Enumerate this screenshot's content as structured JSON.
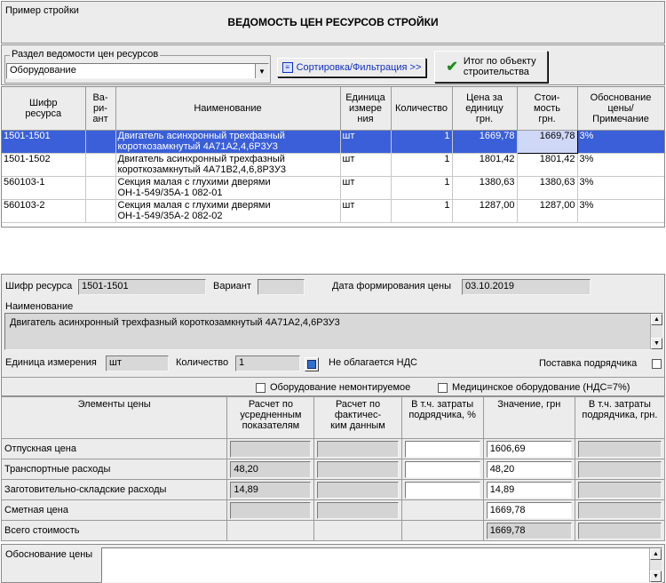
{
  "header": {
    "caption": "Пример стройки",
    "title": "ВЕДОМОСТЬ ЦЕН РЕСУРСОВ СТРОЙКИ"
  },
  "section": {
    "group_label": "Раздел ведомости цен ресурсов",
    "selected": "Оборудование",
    "sort_button": "Сортировка/Фильтрация >>",
    "total_button_line1": "Итог по объекту",
    "total_button_line2": "строительства"
  },
  "grid": {
    "columns": [
      {
        "l1": "Шифр",
        "l2": "ресурса",
        "l3": "",
        "l4": ""
      },
      {
        "l1": "Ва-",
        "l2": "ри-",
        "l3": "ант",
        "l4": ""
      },
      {
        "l1": "Наименование",
        "l2": "",
        "l3": "",
        "l4": ""
      },
      {
        "l1": "Единица",
        "l2": "измере",
        "l3": "ния",
        "l4": ""
      },
      {
        "l1": "Количество",
        "l2": "",
        "l3": "",
        "l4": ""
      },
      {
        "l1": "Цена за",
        "l2": "единицу",
        "l3": "грн.",
        "l4": ""
      },
      {
        "l1": "Стои-",
        "l2": "мость",
        "l3": "грн.",
        "l4": ""
      },
      {
        "l1": "Обоснование",
        "l2": "цены/",
        "l3": "Примечание",
        "l4": ""
      }
    ],
    "rows": [
      {
        "code": "1501-1501",
        "variant": "",
        "name1": "Двигатель асинхронный трехфазный",
        "name2": "короткозамкнутый 4А71А2,4,6Р3У3",
        "unit": "шт",
        "qty": "1",
        "price": "1669,78",
        "cost": "1669,78",
        "note": "3%"
      },
      {
        "code": "1501-1502",
        "variant": "",
        "name1": "Двигатель асинхронный трехфазный",
        "name2": "короткозамкнутый 4А71В2,4,6,8Р3У3",
        "unit": "шт",
        "qty": "1",
        "price": "1801,42",
        "cost": "1801,42",
        "note": "3%"
      },
      {
        "code": "560103-1",
        "variant": "",
        "name1": "Секция малая с глухими дверями",
        "name2": "ОН-1-549/35А-1 082-01",
        "unit": "шт",
        "qty": "1",
        "price": "1380,63",
        "cost": "1380,63",
        "note": "3%"
      },
      {
        "code": "560103-2",
        "variant": "",
        "name1": "Секция малая с глухими дверями",
        "name2": "ОН-1-549/35А-2 082-02",
        "unit": "шт",
        "qty": "1",
        "price": "1287,00",
        "cost": "1287,00",
        "note": "3%"
      }
    ]
  },
  "detail": {
    "code_label": "Шифр ресурса",
    "code": "1501-1501",
    "variant_label": "Вариант",
    "variant": "",
    "date_label": "Дата формирования цены",
    "date": "03.10.2019",
    "name_label": "Наименование",
    "name": "Двигатель асинхронный трехфазный короткозамкнутый 4А71А2,4,6Р3У3",
    "unit_label": "Единица измерения",
    "unit": "шт",
    "qty_label": "Количество",
    "qty": "1",
    "vat_label": "Не облагается НДС",
    "contractor_label": "Поставка подрядчика",
    "not_mounted_label": "Оборудование немонтируемое",
    "medical_label": "Медицинское оборудование (НДС=7%)",
    "justification_label": "Обоснование цены"
  },
  "price_table": {
    "headers": {
      "c1": "Элементы цены",
      "c2_1": "Расчет по",
      "c2_2": "усредненным",
      "c2_3": "показателям",
      "c3_1": "Расчет по",
      "c3_2": "фактичес-",
      "c3_3": "ким данным",
      "c4_1": "В т.ч. затраты",
      "c4_2": "подрядчика, %",
      "c5_1": "Значение, грн",
      "c6_1": "В т.ч. затраты",
      "c6_2": "подрядчика, грн."
    },
    "rows": [
      {
        "label": "Отпускная цена",
        "avg": "",
        "fact": "",
        "pct": "",
        "value": "1606,69",
        "contr": ""
      },
      {
        "label": "Транспортные расходы",
        "avg": "48,20",
        "fact": "",
        "pct": "",
        "value": "48,20",
        "contr": ""
      },
      {
        "label": "Заготовительно-складские расходы",
        "avg": "14,89",
        "fact": "",
        "pct": "",
        "value": "14,89",
        "contr": ""
      },
      {
        "label": "Сметная цена",
        "avg": "",
        "fact": "",
        "pct": "",
        "value": "1669,78",
        "contr": ""
      },
      {
        "label": "Всего стоимость",
        "avg": "",
        "fact": "",
        "pct": "",
        "value": "1669,78",
        "contr": ""
      }
    ]
  },
  "colors": {
    "selection": "#3a5fd8",
    "panel": "#ececec",
    "field": "#d8d8d8"
  }
}
